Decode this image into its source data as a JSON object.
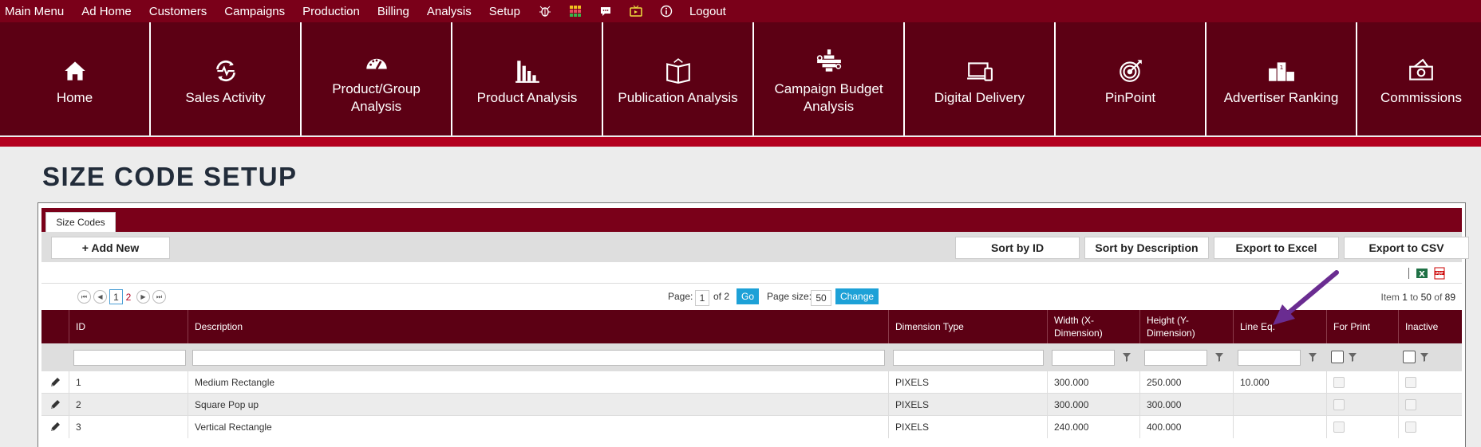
{
  "top_menu": {
    "items": [
      "Main Menu",
      "Ad Home",
      "Customers",
      "Campaigns",
      "Production",
      "Billing",
      "Analysis",
      "Setup"
    ],
    "icons": [
      "bug-icon",
      "grid-icon",
      "chat-icon",
      "tv-icon",
      "info-icon"
    ],
    "logout": "Logout"
  },
  "tiles": [
    {
      "label": "Home",
      "icon": "home-icon"
    },
    {
      "label": "Sales Activity",
      "icon": "refresh-pulse-icon"
    },
    {
      "label": "Product/Group Analysis",
      "icon": "gauge-icon"
    },
    {
      "label": "Product Analysis",
      "icon": "bar-chart-icon"
    },
    {
      "label": "Publication Analysis",
      "icon": "book-icon"
    },
    {
      "label": "Campaign Budget Analysis",
      "icon": "budget-icon"
    },
    {
      "label": "Digital Delivery",
      "icon": "devices-icon"
    },
    {
      "label": "PinPoint",
      "icon": "target-icon"
    },
    {
      "label": "Advertiser Ranking",
      "icon": "podium-icon"
    },
    {
      "label": "Commissions",
      "icon": "money-icon"
    }
  ],
  "page": {
    "title": "SIZE CODE SETUP"
  },
  "grid": {
    "tab": "Size Codes",
    "buttons": {
      "add_new": "+ Add New",
      "sort_id": "Sort by ID",
      "sort_desc": "Sort by Description",
      "export_excel": "Export to Excel",
      "export_csv": "Export to CSV"
    },
    "pager": {
      "pages": [
        "1",
        "2"
      ],
      "page_label": "Page:",
      "page_value": "1",
      "of_label": "of 2",
      "go": "Go",
      "size_label": "Page size:",
      "size_value": "50",
      "change": "Change",
      "info_prefix": "Item",
      "info_from": "1",
      "info_to_label": "to",
      "info_to": "50",
      "info_of_label": "of",
      "info_total": "89"
    },
    "columns": [
      "ID",
      "Description",
      "Dimension Type",
      "Width (X-Dimension)",
      "Height (Y-Dimension)",
      "Line Eq.",
      "For Print",
      "Inactive"
    ],
    "rows": [
      {
        "id": "1",
        "description": "Medium Rectangle",
        "dim_type": "PIXELS",
        "width": "300.000",
        "height": "250.000",
        "line_eq": "10.000"
      },
      {
        "id": "2",
        "description": "Square Pop up",
        "dim_type": "PIXELS",
        "width": "300.000",
        "height": "300.000",
        "line_eq": ""
      },
      {
        "id": "3",
        "description": "Vertical Rectangle",
        "dim_type": "PIXELS",
        "width": "240.000",
        "height": "400.000",
        "line_eq": ""
      }
    ]
  },
  "colors": {
    "brand": "#7a0019",
    "brand_dark": "#5c0014",
    "accent_red": "#b3001f",
    "pager_blue": "#1da1d7",
    "arrow": "#6a2c91"
  }
}
